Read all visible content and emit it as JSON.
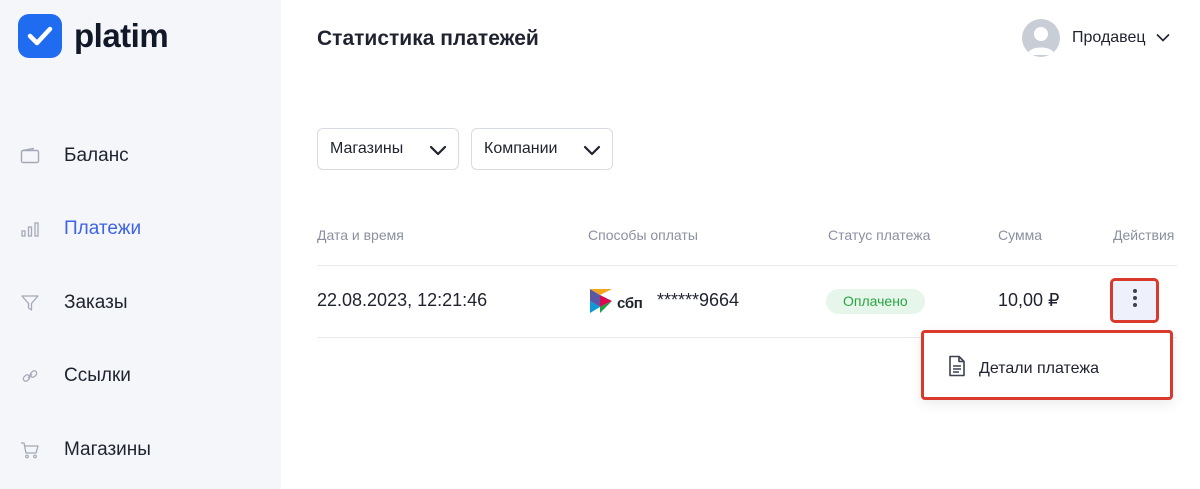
{
  "brand": {
    "name": "platim",
    "color": "#1f6cf0"
  },
  "sidebar": {
    "items": [
      {
        "label": "Баланс",
        "icon": "wallet-icon",
        "active": false
      },
      {
        "label": "Платежи",
        "icon": "bar-chart-icon",
        "active": true
      },
      {
        "label": "Заказы",
        "icon": "filter-icon",
        "active": false
      },
      {
        "label": "Ссылки",
        "icon": "link-icon",
        "active": false
      },
      {
        "label": "Магазины",
        "icon": "cart-icon",
        "active": false
      }
    ]
  },
  "header": {
    "title": "Статистика платежей",
    "user": {
      "name": "Продавец",
      "icon": "user-avatar-icon"
    }
  },
  "filters": [
    {
      "label": "Магазины",
      "icon": "chevron-down-icon"
    },
    {
      "label": "Компании",
      "icon": "chevron-down-icon"
    }
  ],
  "table": {
    "columns": [
      "Дата и время",
      "Способы оплаты",
      "Статус платежа",
      "Сумма",
      "Действия"
    ],
    "rows": [
      {
        "datetime": "22.08.2023, 12:21:46",
        "method": {
          "brand": "сбп",
          "masked": "******9664",
          "icon": "sbp-logo-icon"
        },
        "status": "Оплачено",
        "amount": "10,00 ₽",
        "actions_icon": "more-vertical-icon"
      }
    ]
  },
  "context_menu": {
    "items": [
      {
        "label": "Детали платежа",
        "icon": "document-icon"
      }
    ]
  },
  "colors": {
    "accent": "#3f63e6",
    "status_paid_bg": "#e6f6ea",
    "status_paid_text": "#2aa544",
    "highlight": "#d93a2b"
  }
}
